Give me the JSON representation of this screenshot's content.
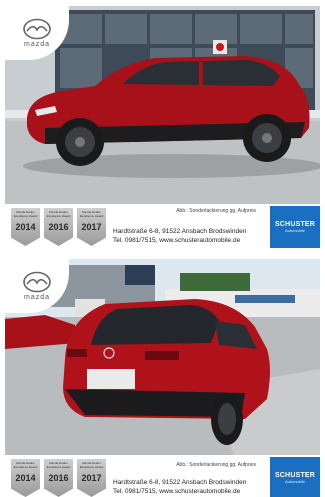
{
  "listing_images": [
    {
      "brand_logo_text": "mazda",
      "caption": "Abb.: Sonderlackierung gg. Aufpreis",
      "badges": [
        {
          "label": "Mazda Dealer Excellence Award",
          "year": "2014"
        },
        {
          "label": "Mazda Dealer Excellence Award",
          "year": "2016"
        },
        {
          "label": "Mazda Dealer Excellence Award",
          "year": "2017"
        }
      ],
      "dealer_address": "Hardtstraße 6-8, 91522 Ansbach Brodswinden",
      "dealer_contact": "Tel. 0981/7515, www.schusterautomobile.de",
      "dealer_logo_name": "SCHUSTER",
      "dealer_logo_sub": "Automobile"
    },
    {
      "brand_logo_text": "mazda",
      "caption": "Abb.: Sonderlackierung gg. Aufpreis",
      "badges": [
        {
          "label": "Mazda Dealer Excellence Award",
          "year": "2014"
        },
        {
          "label": "Mazda Dealer Excellence Award",
          "year": "2016"
        },
        {
          "label": "Mazda Dealer Excellence Award",
          "year": "2017"
        }
      ],
      "dealer_address": "Hardtstraße 6-8, 91522 Ansbach Brodswinden",
      "dealer_contact": "Tel. 0981/7515, www.schusterautomobile.de",
      "dealer_logo_name": "SCHUSTER",
      "dealer_logo_sub": "Automobile"
    }
  ],
  "colors": {
    "car_red": "#b0121b",
    "dealer_blue": "#1b6fc1",
    "badge_silver": "#b5b5b5"
  },
  "icons": [
    "mazda-logo-icon",
    "award-badge-icon"
  ]
}
